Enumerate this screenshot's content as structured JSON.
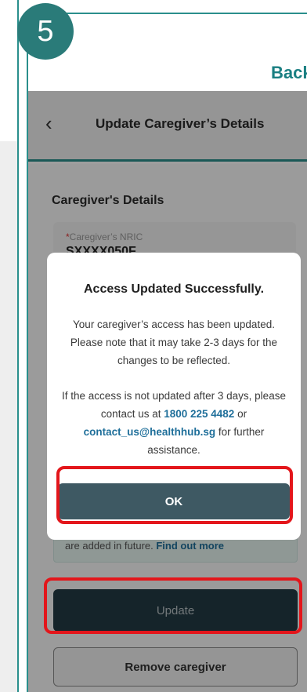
{
  "step": {
    "number": "5"
  },
  "topbar": {
    "back_label": "Back"
  },
  "header": {
    "title": "Update Caregiver’s Details"
  },
  "form": {
    "section_title": "Caregiver's Details",
    "nric_label_required": "*",
    "nric_label": "Caregiver’s NRIC",
    "nric_value": "SXXXX050F",
    "info_text": "are added in future. ",
    "info_link": "Find out more"
  },
  "buttons": {
    "update_label": "Update",
    "remove_label": "Remove caregiver"
  },
  "modal": {
    "title": "Access Updated Successfully.",
    "para1": "Your caregiver’s access has been updated. Please note that it may take 2-3 days for the changes to be reflected.",
    "para2_before": "If the access is not updated after 3 days, please contact us at ",
    "phone": "1800 225 4482",
    "para2_mid": " or ",
    "email": "contact_us@healthhub.sg",
    "para2_after": " for further assistance.",
    "ok_label": "OK"
  },
  "colors": {
    "teal_accent": "#2a8f8c",
    "badge": "#2a7b79",
    "link": "#1f6f9a",
    "highlight_red": "#e3161b",
    "update_button": "#233a44",
    "ok_button": "#3e5963"
  }
}
